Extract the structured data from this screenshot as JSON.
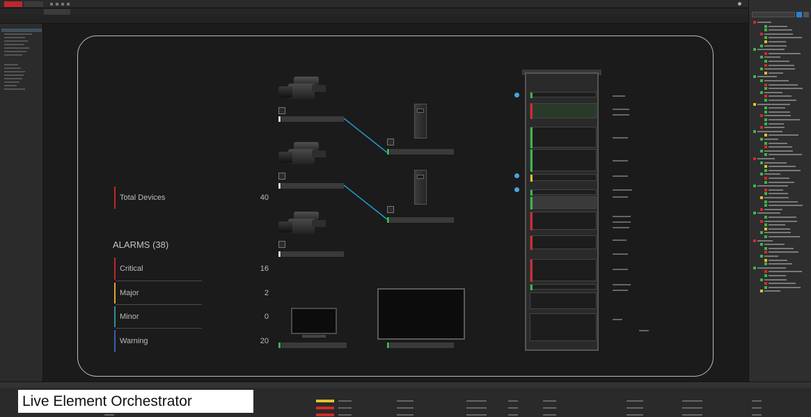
{
  "canvas": {
    "total_devices_label": "Total Devices",
    "total_devices_value": "40",
    "alarms_title": "ALARMS (38)",
    "alarms": [
      {
        "label": "Critical",
        "value": "16",
        "color": "#c0272d"
      },
      {
        "label": "Major",
        "value": "2",
        "color": "#e0a526"
      },
      {
        "label": "Minor",
        "value": "0",
        "color": "#2f8fa0"
      },
      {
        "label": "Warning",
        "value": "20",
        "color": "#3a5fb0"
      }
    ]
  },
  "caption": {
    "text": "Live Element Orchestrator"
  },
  "colors": {
    "brand": "#c0272d",
    "ok": "#3fb44b",
    "critical": "#d42a2a",
    "warning": "#e3c128",
    "link": "#1e9fd0",
    "selection": "#2f7fd6"
  }
}
